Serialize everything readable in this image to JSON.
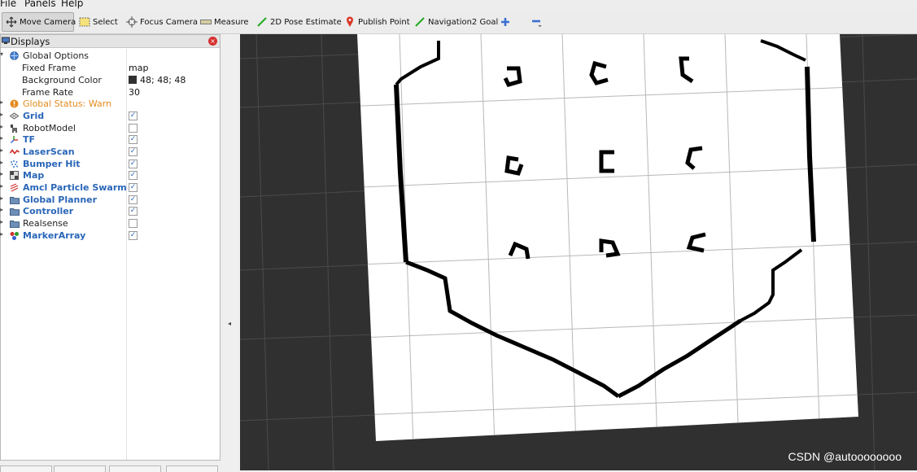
{
  "menu": [
    "File",
    "Panels",
    "Help"
  ],
  "toolbar": {
    "tools": [
      "Move Camera",
      "Select",
      "Focus Camera",
      "Measure",
      "2D Pose Estimate",
      "Publish Point",
      "Navigation2 Goal"
    ],
    "icons": [
      "move-camera-icon",
      "select-icon",
      "focus-camera-icon",
      "measure-icon",
      "pose-estimate-icon",
      "publish-point-icon",
      "nav-goal-icon",
      "add-tool-icon",
      "remove-tool-icon"
    ]
  },
  "displays_panel": {
    "title": "Displays",
    "global_options": {
      "label": "Global Options",
      "fixed_frame_label": "Fixed Frame",
      "fixed_frame_value": "map",
      "background_color_label": "Background Color",
      "background_color_value": "48; 48; 48",
      "frame_rate_label": "Frame Rate",
      "frame_rate_value": "30"
    },
    "global_status": "Global Status: Warn",
    "items": [
      {
        "label": "Grid",
        "checked": true
      },
      {
        "label": "RobotModel",
        "checked": false
      },
      {
        "label": "TF",
        "checked": true
      },
      {
        "label": "LaserScan",
        "checked": true
      },
      {
        "label": "Bumper Hit",
        "checked": true
      },
      {
        "label": "Map",
        "checked": true
      },
      {
        "label": "Amcl Particle Swarm",
        "checked": true
      },
      {
        "label": "Global Planner",
        "checked": true
      },
      {
        "label": "Controller",
        "checked": true
      },
      {
        "label": "Realsense",
        "checked": false
      },
      {
        "label": "MarkerArray",
        "checked": true
      }
    ]
  },
  "watermark": "CSDN @autoooooooo",
  "colors": {
    "view_background": "#303030",
    "map_free": "#ffffff",
    "map_occupied": "#000000",
    "grid_line": "#a0a0a0",
    "accent_blue": "#2a66b8",
    "warn_orange": "#e48a1c"
  }
}
